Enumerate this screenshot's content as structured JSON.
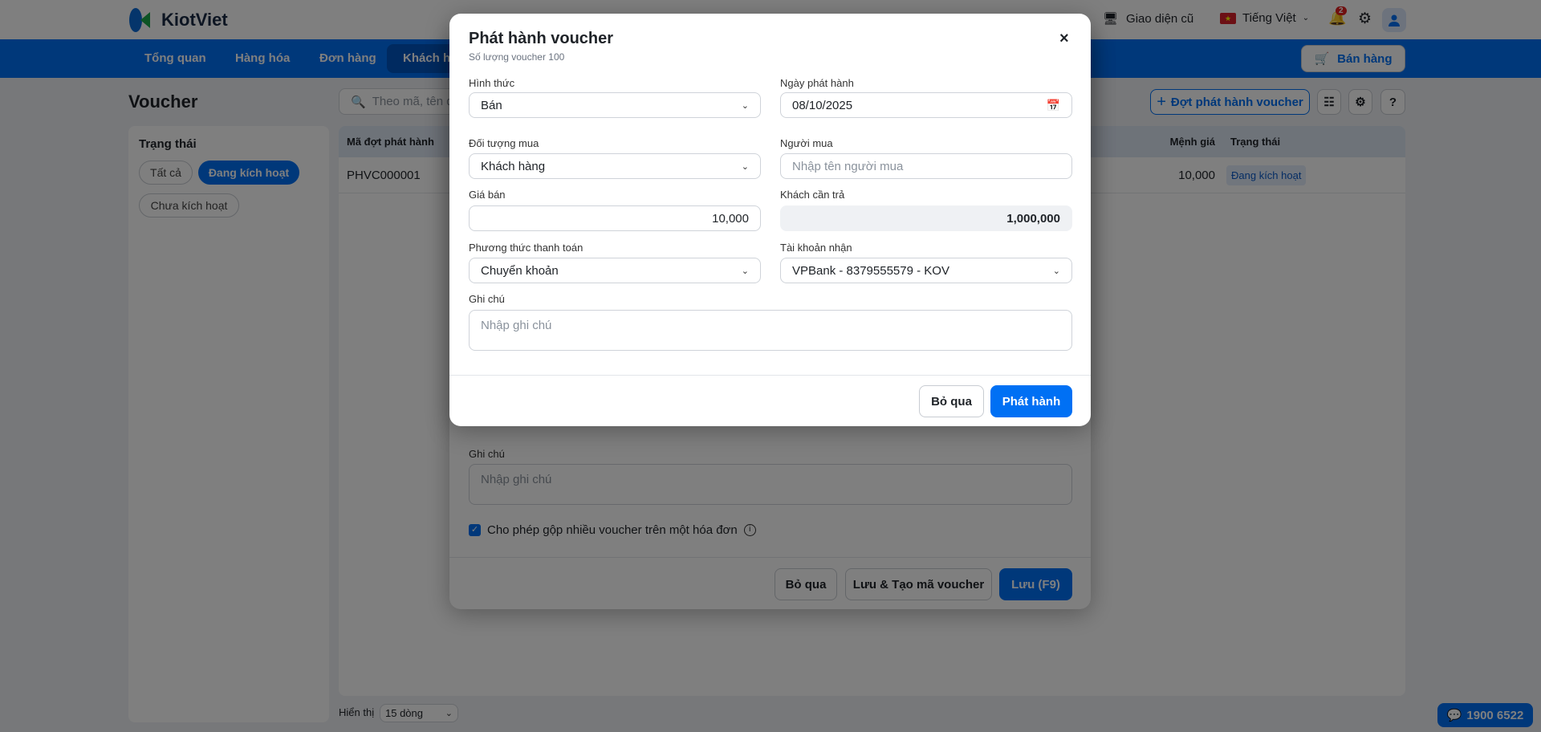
{
  "brand": {
    "name": "KiotViet"
  },
  "topbar": {
    "old_ui": "Giao diện cũ",
    "language": "Tiếng Việt",
    "notif_count": "2"
  },
  "nav": {
    "items": [
      "Tổng quan",
      "Hàng hóa",
      "Đơn hàng",
      "Khách hàng"
    ],
    "sell": "Bán hàng"
  },
  "page": {
    "title": "Voucher",
    "search_placeholder": "Theo mã, tên đợt phát hành",
    "new_batch": "Đợt phát hành voucher"
  },
  "filter": {
    "title": "Trạng thái",
    "chips": [
      "Tất cả",
      "Đang kích hoạt",
      "Chưa kích hoạt"
    ]
  },
  "table": {
    "headers": [
      "Mã đợt phát hành",
      "Mệnh giá",
      "Trạng thái"
    ],
    "rows": [
      {
        "code": "PHVC000001",
        "value": "10,000",
        "status": "Đang kích hoạt"
      }
    ]
  },
  "pager": {
    "label": "Hiển thị",
    "size": "15 dòng"
  },
  "hotline": "1900 6522",
  "back_modal": {
    "note_label": "Ghi chú",
    "note_placeholder": "Nhập ghi chú",
    "merge_label": "Cho phép gộp nhiều voucher trên một hóa đơn",
    "merge_checked": true,
    "cancel": "Bỏ qua",
    "save_create": "Lưu & Tạo mã voucher",
    "save": "Lưu (F9)"
  },
  "modal": {
    "title": "Phát hành voucher",
    "subtitle": "Số lượng voucher 100",
    "type_label": "Hình thức",
    "type_value": "Bán",
    "date_label": "Ngày phát hành",
    "date_value": "08/10/2025",
    "target_label": "Đối tượng mua",
    "target_value": "Khách hàng",
    "buyer_label": "Người mua",
    "buyer_placeholder": "Nhập tên người mua",
    "price_label": "Giá bán",
    "price_value": "10,000",
    "due_label": "Khách cần trả",
    "due_value": "1,000,000",
    "pay_label": "Phương thức thanh toán",
    "pay_value": "Chuyển khoản",
    "account_label": "Tài khoản nhận",
    "account_value": "VPBank - 8379555579 - KOV",
    "note_label": "Ghi chú",
    "note_placeholder": "Nhập ghi chú",
    "cancel": "Bỏ qua",
    "submit": "Phát hành"
  }
}
